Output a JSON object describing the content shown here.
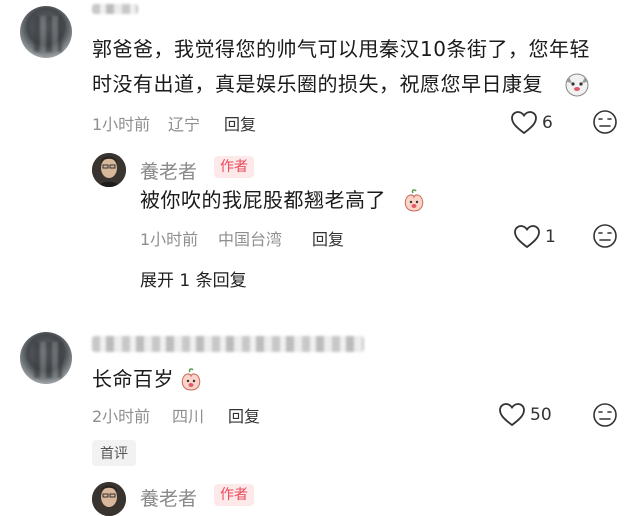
{
  "comments": [
    {
      "text_line1": "郭爸爸，我觉得您的帅气可以甩秦汉10条街了，您年轻",
      "text_line2": "时没有出道，真是娱乐圈的损失，祝愿您早日康复",
      "time": "1小时前",
      "location": "辽宁",
      "reply_label": "回复",
      "likes": "6",
      "emoji_icon": "husky-emoji-icon"
    },
    {
      "text": "长命百岁",
      "time": "2小时前",
      "location": "四川",
      "reply_label": "回复",
      "likes": "50",
      "badge": "首评",
      "emoji_icon": "peach-emoji-icon"
    }
  ],
  "replies": [
    {
      "author": "養老者",
      "tag": "作者",
      "text": "被你吹的我屁股都翘老高了",
      "time": "1小时前",
      "location": "中国台湾",
      "reply_label": "回复",
      "likes": "1",
      "emoji_icon": "peach-emoji-icon"
    },
    {
      "author": "養老者",
      "tag": "作者"
    }
  ],
  "expand_label": "展开 1 条回复",
  "colors": {
    "tag": "#ea4a5a",
    "tag_bg": "#fde8ea",
    "meta": "#8f8f8f"
  }
}
